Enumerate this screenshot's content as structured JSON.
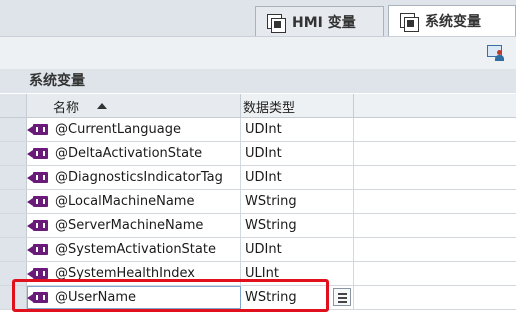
{
  "tabs": [
    {
      "label": "HMI 变量",
      "active": false
    },
    {
      "label": "系统变量",
      "active": true
    }
  ],
  "section": {
    "title": "系统变量"
  },
  "table": {
    "columns": {
      "name": "名称",
      "datatype": "数据类型"
    },
    "rows": [
      {
        "name": "@CurrentLanguage",
        "type": "UDInt"
      },
      {
        "name": "@DeltaActivationState",
        "type": "UDInt"
      },
      {
        "name": "@DiagnosticsIndicatorTag",
        "type": "UDInt"
      },
      {
        "name": "@LocalMachineName",
        "type": "WString"
      },
      {
        "name": "@ServerMachineName",
        "type": "WString"
      },
      {
        "name": "@SystemActivationState",
        "type": "UDInt"
      },
      {
        "name": "@SystemHealthIndex",
        "type": "ULInt"
      },
      {
        "name": "@UserName",
        "type": "WString"
      }
    ]
  },
  "colors": {
    "highlight": "#e0111c",
    "tag_icon": "#6a1b7a"
  }
}
